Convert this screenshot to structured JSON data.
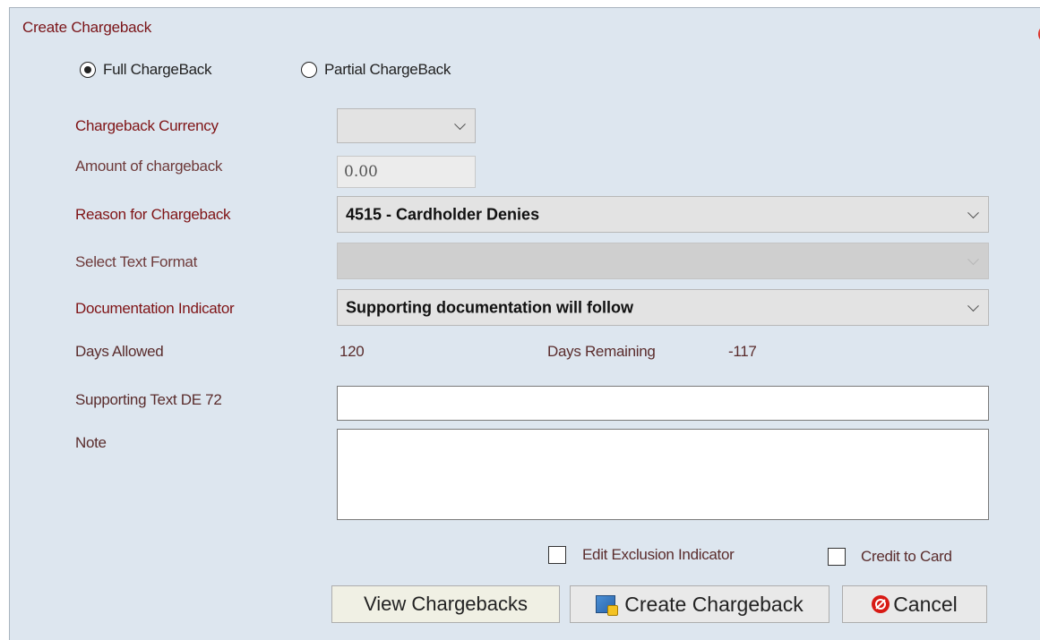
{
  "dialog": {
    "title": "Create Chargeback",
    "close_icon": "close-icon"
  },
  "chargeback_type": {
    "options": [
      "Full ChargeBack",
      "Partial ChargeBack"
    ],
    "selected": "Full ChargeBack"
  },
  "form": {
    "currency_label": "Chargeback Currency",
    "currency_value": "",
    "amount_label": "Amount of chargeback",
    "amount_value": "0.00",
    "reason_label": "Reason for Chargeback",
    "reason_value": "4515 - Cardholder Denies",
    "text_format_label": "Select Text Format",
    "text_format_value": "",
    "doc_indicator_label": "Documentation Indicator",
    "doc_indicator_value": "Supporting documentation will follow",
    "days_allowed_label": "Days Allowed",
    "days_allowed_value": "120",
    "days_remaining_label": "Days Remaining",
    "days_remaining_value": "-117",
    "supporting_text_label": "Supporting Text DE 72",
    "supporting_text_value": "",
    "note_label": "Note",
    "note_value": ""
  },
  "options": {
    "edit_exclusion_label": "Edit Exclusion Indicator",
    "edit_exclusion_checked": false,
    "credit_to_card_label": "Credit to Card",
    "credit_to_card_checked": false
  },
  "buttons": {
    "view_chargebacks": "View Chargebacks",
    "create_chargeback": "Create Chargeback",
    "create_icon": "create-chargeback-icon",
    "cancel": "Cancel",
    "cancel_icon": "cancel-icon"
  },
  "colors": {
    "dialog_bg": "#dde6ef",
    "label_red": "#7f1416"
  }
}
